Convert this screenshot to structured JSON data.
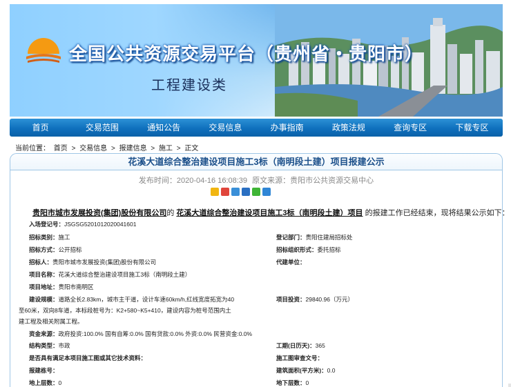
{
  "banner": {
    "title": "全国公共资源交易平台（贵州省・贵阳市）",
    "subtitle": "工程建设类",
    "colors": {
      "sky": "#5fa8e6",
      "title_fill": "#ffffff",
      "title_outline": "#1e5fb3",
      "sun": "#f59a12"
    }
  },
  "nav": {
    "items": [
      "首页",
      "交易范围",
      "通知公告",
      "交易信息",
      "办事指南",
      "政策法规",
      "查询专区",
      "下载专区"
    ]
  },
  "breadcrumb": [
    "当前位置：",
    "首页",
    ">",
    "交易信息",
    ">",
    "报建信息",
    ">",
    "施工",
    ">",
    "正文"
  ],
  "article": {
    "title": "花溪大道综合整治建设项目施工3标（南明段土建）项目报建公示",
    "publish_time": "发布时间：2020-04-16 16:08:39",
    "source": "原文来源：贵阳市公共资源交易中心",
    "share_icons": [
      "qzone-icon",
      "weibo-icon",
      "qq-icon",
      "renren-icon",
      "wechat-icon",
      "more-share-icon"
    ],
    "intro_org": "贵阳市城市发展投资(集团)股份有限公司",
    "intro_mid": "的",
    "intro_project": "花溪大道综合整治建设项目施工3标（南明段土建）项目",
    "intro_tail": "的报建工作已经结束，现将结果公示如下：",
    "fields": {
      "entry_no_label": "入场登记号：",
      "entry_no": "JSGSG5201012020041601",
      "category_label": "招标类别：",
      "category": "施工",
      "register_dept_label": "登记部门：",
      "register_dept": "贵阳住建局招标处",
      "method_label": "招标方式：",
      "method": "公开招标",
      "org_form_label": "招标组织形式：",
      "org_form": "委托招标",
      "tenderer_label": "招标人：",
      "tenderer": "贵阳市城市发展投资(集团)股份有限公司",
      "agent_label": "代建单位：",
      "agent": "",
      "project_name_label": "项目名称：",
      "project_name": "花溪大道综合整治建设项目施工3标（南明段土建）",
      "address_label": "项目地址：",
      "address": "贵阳市南明区",
      "scale_label": "建设规模：",
      "scale_line1": "道路全长2.83km，城市主干道，设计车速60km/h,红线宽度拓宽为40",
      "scale_line2": "至60米，双向8车道，本标段桩号为：K2+580~K5+410，建设内容为桩号范围内土",
      "scale_line3": "建工程及相关附属工程。",
      "investment_label": "项目投资：",
      "investment": "29840.96（万元）",
      "funding_label": "资金来源：",
      "funding": "政府投资:100.0% 国有自筹:0.0% 国有贷款:0.0% 外资:0.0% 民营资金:0.0%",
      "structure_label": "结构类型：",
      "structure": "市政",
      "duration_label": "工期(日历天)：",
      "duration": "365",
      "drawings_label": "是否具有满足本项目施工图或其它技术资料：",
      "drawings": "",
      "review_no_label": "施工图审查文号：",
      "review_no": "",
      "building_no_label": "报建栋号：",
      "building_no": "",
      "area_label": "建筑面积(平方米)：",
      "area": "0.0",
      "floors_above_label": "地上层数：",
      "floors_above": "0",
      "floors_below_label": "地下层数：",
      "floors_below": "0"
    }
  }
}
